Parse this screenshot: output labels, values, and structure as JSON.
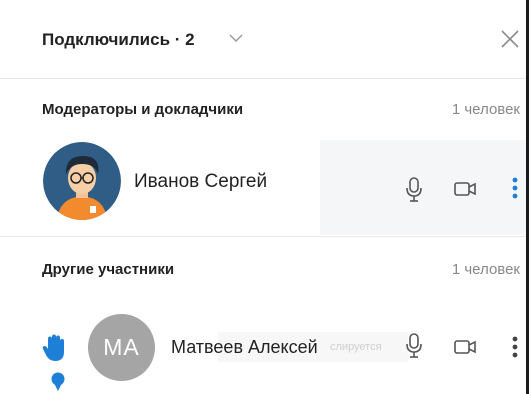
{
  "header": {
    "title": "Подключились · 2",
    "chevron_icon": "chevron-down-icon",
    "close_icon": "close-icon"
  },
  "sections": [
    {
      "title": "Модераторы и докладчики",
      "count": "1 человек",
      "participants": [
        {
          "name": "Иванов Сергей",
          "avatar": "illustrated-avatar",
          "actions": [
            "microphone-icon",
            "camera-icon",
            "more-icon"
          ]
        }
      ]
    },
    {
      "title": "Другие участники",
      "count": "1 человек",
      "participants": [
        {
          "name": "Матвеев Алексей",
          "initials": "МА",
          "hint_text": "слируется",
          "raised_hand": true,
          "actions": [
            "microphone-icon",
            "camera-icon",
            "more-icon"
          ]
        }
      ]
    }
  ],
  "colors": {
    "accent": "#1e7fd6",
    "avatar_gray": "#a5a5a5",
    "muted_text": "#888888"
  }
}
